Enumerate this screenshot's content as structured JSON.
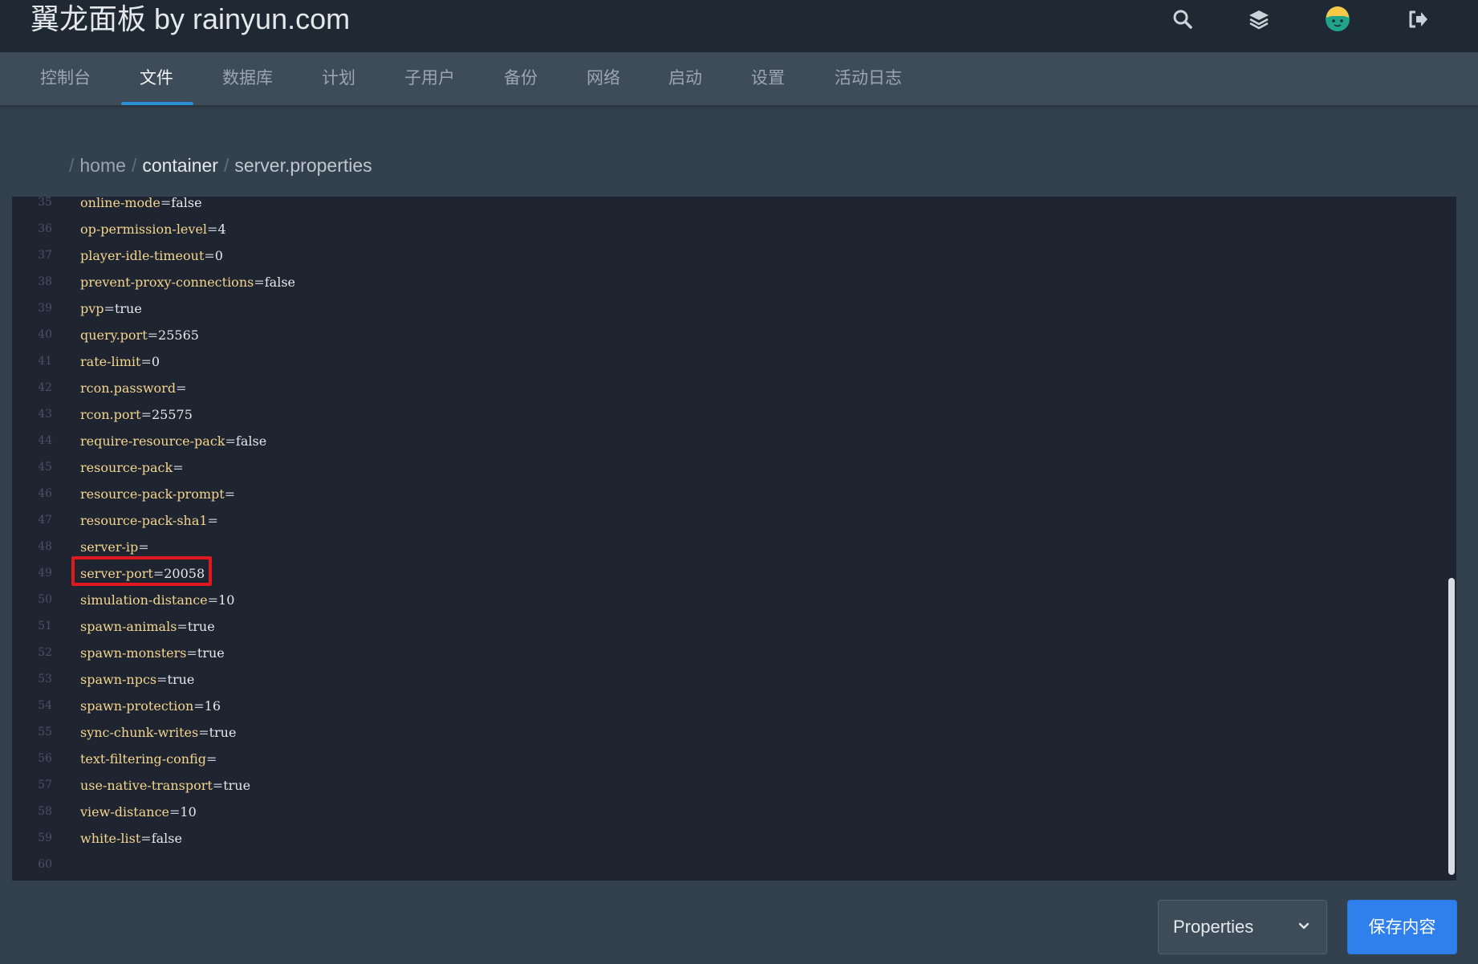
{
  "app": {
    "title": "翼龙面板 by rainyun.com"
  },
  "header_icons": [
    "search-icon",
    "layers-icon",
    "avatar",
    "logout-icon"
  ],
  "nav": {
    "items": [
      {
        "label": "控制台"
      },
      {
        "label": "文件"
      },
      {
        "label": "数据库"
      },
      {
        "label": "计划"
      },
      {
        "label": "子用户"
      },
      {
        "label": "备份"
      },
      {
        "label": "网络"
      },
      {
        "label": "启动"
      },
      {
        "label": "设置"
      },
      {
        "label": "活动日志"
      }
    ],
    "active": "文件"
  },
  "breadcrumb": {
    "separator": "/",
    "home": "home",
    "container": "container",
    "file": "server.properties"
  },
  "editor": {
    "lines": [
      {
        "n": "35",
        "key": "online-mode",
        "value": "false"
      },
      {
        "n": "36",
        "key": "op-permission-level",
        "value": "4"
      },
      {
        "n": "37",
        "key": "player-idle-timeout",
        "value": "0"
      },
      {
        "n": "38",
        "key": "prevent-proxy-connections",
        "value": "false"
      },
      {
        "n": "39",
        "key": "pvp",
        "value": "true"
      },
      {
        "n": "40",
        "key": "query.port",
        "value": "25565"
      },
      {
        "n": "41",
        "key": "rate-limit",
        "value": "0"
      },
      {
        "n": "42",
        "key": "rcon.password",
        "value": ""
      },
      {
        "n": "43",
        "key": "rcon.port",
        "value": "25575"
      },
      {
        "n": "44",
        "key": "require-resource-pack",
        "value": "false"
      },
      {
        "n": "45",
        "key": "resource-pack",
        "value": ""
      },
      {
        "n": "46",
        "key": "resource-pack-prompt",
        "value": ""
      },
      {
        "n": "47",
        "key": "resource-pack-sha1",
        "value": ""
      },
      {
        "n": "48",
        "key": "server-ip",
        "value": ""
      },
      {
        "n": "49",
        "key": "server-port",
        "value": "20058"
      },
      {
        "n": "50",
        "key": "simulation-distance",
        "value": "10"
      },
      {
        "n": "51",
        "key": "spawn-animals",
        "value": "true"
      },
      {
        "n": "52",
        "key": "spawn-monsters",
        "value": "true"
      },
      {
        "n": "53",
        "key": "spawn-npcs",
        "value": "true"
      },
      {
        "n": "54",
        "key": "spawn-protection",
        "value": "16"
      },
      {
        "n": "55",
        "key": "sync-chunk-writes",
        "value": "true"
      },
      {
        "n": "56",
        "key": "text-filtering-config",
        "value": ""
      },
      {
        "n": "57",
        "key": "use-native-transport",
        "value": "true"
      },
      {
        "n": "58",
        "key": "view-distance",
        "value": "10"
      },
      {
        "n": "59",
        "key": "white-list",
        "value": "false"
      },
      {
        "n": "60",
        "key": "",
        "value": ""
      }
    ],
    "highlighted_line": "49"
  },
  "footer": {
    "language_select": "Properties",
    "save_button": "保存内容"
  },
  "colors": {
    "accent": "#2f80ed",
    "highlight": "#e0191f",
    "key": "#f4d58d",
    "editor_bg": "#1e2430"
  }
}
